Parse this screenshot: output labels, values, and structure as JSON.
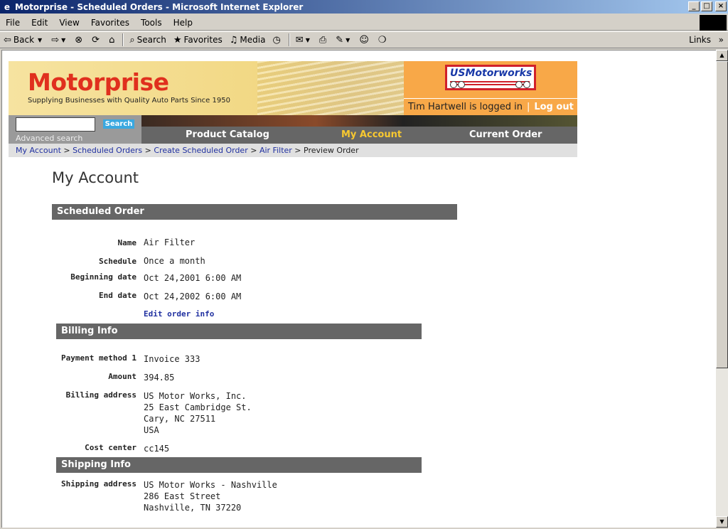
{
  "window": {
    "title": "Motorprise - Scheduled Orders - Microsoft Internet Explorer",
    "buttons": [
      "_",
      "□",
      "×"
    ]
  },
  "menu": [
    "File",
    "Edit",
    "View",
    "Favorites",
    "Tools",
    "Help"
  ],
  "toolbar": {
    "back": "Back",
    "search": "Search",
    "favorites": "Favorites",
    "media": "Media",
    "links": "Links"
  },
  "site": {
    "logo": "Motorprise",
    "tagline": "Supplying Businesses with Quality Auto Parts Since 1950",
    "partner_logo": "USMotorworks",
    "logged_in": "Tim Hartwell is logged in",
    "logout": "Log out",
    "search_button": "Search",
    "advanced_search": "Advanced search",
    "nav": [
      "Product Catalog",
      "My Account",
      "Current Order"
    ],
    "active_nav": "My Account"
  },
  "breadcrumb": {
    "links": [
      "My Account",
      "Scheduled Orders",
      "Create Scheduled Order",
      "Air Filter"
    ],
    "current": "Preview Order",
    "separator": ">"
  },
  "page": {
    "title": "My Account",
    "scheduled_order": {
      "heading": "Scheduled Order",
      "name_label": "Name",
      "name": "Air Filter",
      "schedule_label": "Schedule",
      "schedule": "Once a month",
      "begin_label": "Beginning date",
      "begin": "Oct 24,2001 6:00 AM",
      "end_label": "End date",
      "end": "Oct 24,2002 6:00 AM",
      "edit_link": "Edit order info"
    },
    "billing": {
      "heading": "Billing Info",
      "payment_label": "Payment method 1",
      "payment": "Invoice 333",
      "amount_label": "Amount",
      "amount": "394.85",
      "address_label": "Billing address",
      "address": [
        "US Motor Works, Inc.",
        "25 East Cambridge St.",
        "Cary, NC 27511",
        "USA"
      ],
      "cost_center_label": "Cost center",
      "cost_center": "cc145"
    },
    "shipping": {
      "heading": "Shipping Info",
      "address_label": "Shipping address",
      "address": [
        "US Motor Works - Nashville",
        "286 East Street",
        "Nashville, TN 37220"
      ]
    }
  },
  "colors": {
    "title_gradient_start": "#0a246a",
    "logo_red": "#e0301e",
    "partner_orange": "#f8a848",
    "nav_gray": "#666666",
    "active_nav": "#f8c830",
    "link_blue": "#2030a0"
  }
}
